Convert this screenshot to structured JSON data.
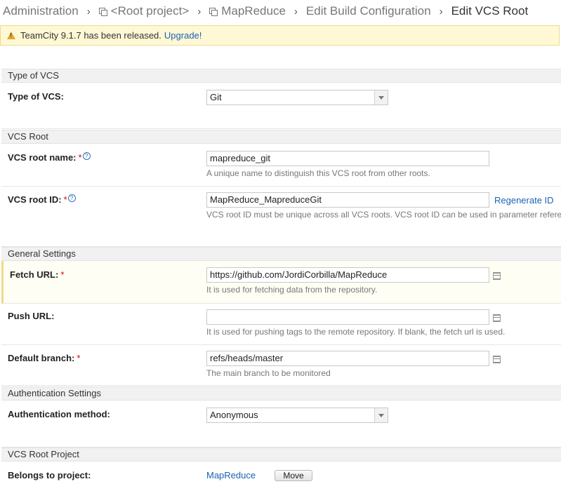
{
  "breadcrumb": {
    "items": [
      "Administration",
      "<Root project>",
      "MapReduce",
      "Edit Build Configuration",
      "Edit VCS Root"
    ]
  },
  "banner": {
    "message": "TeamCity 9.1.7 has been released.",
    "link": "Upgrade!"
  },
  "sections": {
    "type_of_vcs": "Type of VCS",
    "vcs_root": "VCS Root",
    "general_settings": "General Settings",
    "authentication_settings": "Authentication Settings",
    "vcs_root_project": "VCS Root Project"
  },
  "fields": {
    "type_of_vcs": {
      "label": "Type of VCS:",
      "value": "Git"
    },
    "vcs_root_name": {
      "label": "VCS root name:",
      "required": "*",
      "help": "?",
      "value": "mapreduce_git",
      "hint": "A unique name to distinguish this VCS root from other roots."
    },
    "vcs_root_id": {
      "label": "VCS root ID:",
      "required": "*",
      "help": "?",
      "value": "MapReduce_MapreduceGit",
      "action": "Regenerate ID",
      "hint": "VCS root ID must be unique across all VCS roots. VCS root ID can be used in parameter refere"
    },
    "fetch_url": {
      "label": "Fetch URL:",
      "required": "*",
      "value": "https://github.com/JordiCorbilla/MapReduce",
      "hint": "It is used for fetching data from the repository."
    },
    "push_url": {
      "label": "Push URL:",
      "value": "",
      "hint": "It is used for pushing tags to the remote repository. If blank, the fetch url is used."
    },
    "default_branch": {
      "label": "Default branch:",
      "required": "*",
      "value": "refs/heads/master",
      "hint": "The main branch to be monitored"
    },
    "authentication_method": {
      "label": "Authentication method:",
      "value": "Anonymous"
    },
    "belongs_to_project": {
      "label": "Belongs to project:",
      "value": "MapReduce",
      "button": "Move"
    }
  },
  "icons": {
    "warning": "warning-icon",
    "project": "project-icon",
    "help": "help-icon",
    "list": "list-icon",
    "dropdown": "chevron-down-icon"
  },
  "colors": {
    "banner_bg": "#fff8d5",
    "link": "#1a62b3",
    "required": "#dd0000",
    "section_bg": "#f1f1f1"
  }
}
